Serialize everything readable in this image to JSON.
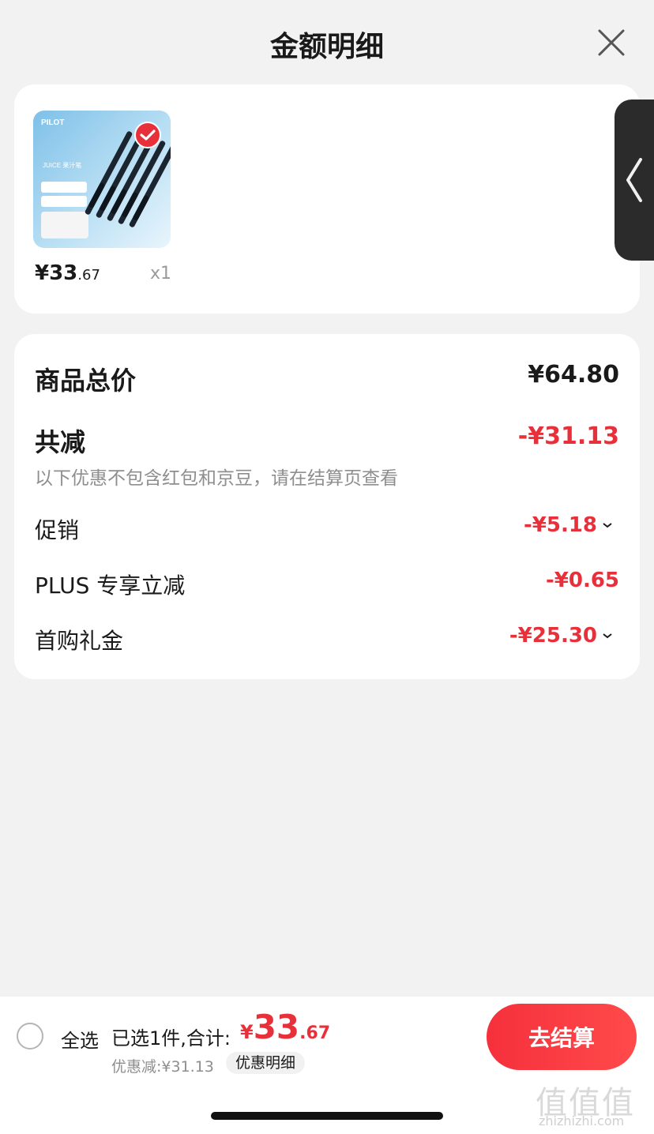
{
  "header": {
    "title": "金额明细"
  },
  "product": {
    "brand": "PILOT",
    "image_subtitle": "JUICE 果汁笔",
    "price_main": "¥33",
    "price_decimal": ".67",
    "quantity": "x1"
  },
  "summary": {
    "total_label": "商品总价",
    "total_value": "¥64.80",
    "reduce_label": "共减",
    "reduce_value": "-¥31.13",
    "note": "以下优惠不包含红包和京豆，请在结算页查看",
    "items": [
      {
        "label": "促销",
        "value": "-¥5.18",
        "expandable": true
      },
      {
        "label": "PLUS 专享立减",
        "value": "-¥0.65",
        "expandable": false
      },
      {
        "label": "首购礼金",
        "value": "-¥25.30",
        "expandable": true
      }
    ]
  },
  "bottom_bar": {
    "select_all": "全选",
    "selected_text": "已选1件,合计:",
    "total_symbol": "¥",
    "total_integer": "33",
    "total_decimal": ".67",
    "discount_text": "优惠减:¥31.13",
    "detail_button": "优惠明细",
    "checkout_button": "去结算"
  },
  "watermark": {
    "glyphs": "值值值",
    "url": "zhizhizhi.com"
  },
  "colors": {
    "accent_red": "#e8303a",
    "text_dark": "#1a1a1a",
    "text_gray": "#8e8e8e"
  },
  "icons": [
    "close-icon",
    "check-icon",
    "chevron-left-icon",
    "chevron-down-icon"
  ]
}
